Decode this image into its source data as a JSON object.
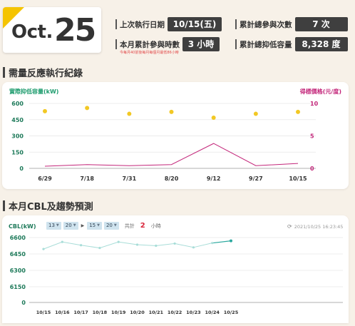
{
  "header": {
    "month": "Oct.",
    "day": "25",
    "last_exec_label": "上次執行日期",
    "last_exec_value": "10/15(五)",
    "month_hours_label": "本月累計參與時數",
    "month_hours_value": "3 小時",
    "total_count_label": "累計總參與次數",
    "total_count_value": "7 次",
    "total_reduction_label": "累計總抑低容量",
    "total_reduction_value": "8,328 度",
    "note": "今每月40前後每月每個月最低86小時"
  },
  "section1": {
    "title": "需量反應執行紀錄"
  },
  "section2": {
    "title": "本月CBL及趨勢預測"
  },
  "chart_data": [
    {
      "type": "line",
      "ylabel": "實際抑低容量(kW)",
      "y2label": "得標價格(元/度)",
      "categories": [
        "6/29",
        "7/18",
        "7/31",
        "8/20",
        "9/12",
        "9/27",
        "10/15"
      ],
      "ylim": [
        0,
        600
      ],
      "yticks": [
        "600",
        "450",
        "300",
        "150",
        "0"
      ],
      "y2lim": [
        0,
        10
      ],
      "y2ticks": [
        "10",
        "5",
        "0"
      ],
      "series": [
        {
          "kind": "line",
          "axis": "left",
          "values": [
            20,
            35,
            25,
            35,
            230,
            25,
            45
          ],
          "color": "#c3267a"
        },
        {
          "kind": "scatter",
          "axis": "right",
          "values": [
            8.8,
            9.3,
            8.4,
            8.7,
            7.8,
            8.4,
            8.7
          ],
          "color": "#f2c824"
        }
      ],
      "colors": {
        "left_axis": "#1e9c6e",
        "right_axis": "#c3267a"
      },
      "grid": true
    },
    {
      "type": "line",
      "ylabel": "CBL(kW)",
      "categories": [
        "10/15",
        "10/16",
        "10/17",
        "10/18",
        "10/19",
        "10/20",
        "10/21",
        "10/22",
        "10/23",
        "10/24",
        "10/25"
      ],
      "ylim": [
        6000,
        6600
      ],
      "yticks": [
        "6600",
        "6450",
        "6300",
        "6150",
        "0"
      ],
      "series": [
        {
          "kind": "line",
          "values": [
            6495,
            6560,
            6530,
            6505,
            6560,
            6535,
            6525,
            6545,
            6510,
            6550,
            6570
          ],
          "color": "#a8ddd8",
          "last_color": "#2aa89e"
        }
      ],
      "grid": true
    }
  ],
  "controls": {
    "from_hour": "13",
    "from_min": "20",
    "to_hour": "15",
    "to_min": "20",
    "total_label": "共計",
    "total_value": "2",
    "total_unit": "小時",
    "timestamp": "2021/10/25 16:23:45"
  }
}
